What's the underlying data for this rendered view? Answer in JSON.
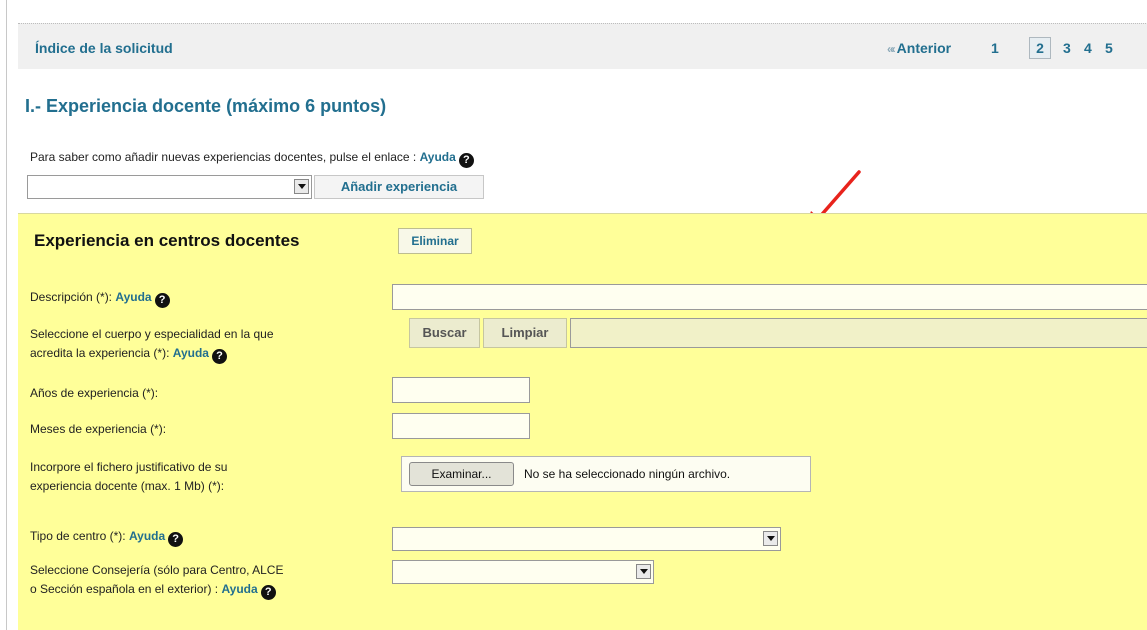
{
  "header": {
    "index_link": "Índice de la solicitud",
    "pager": {
      "prev_label": "Anterior",
      "pages": [
        "1",
        "2",
        "3",
        "4",
        "5"
      ],
      "current": "2"
    }
  },
  "section": {
    "title": "I.- Experiencia docente (máximo 6 puntos)",
    "hint_text": "Para saber como añadir nuevas experiencias docentes, pulse el enlace : ",
    "help_label": "Ayuda",
    "add_select_value": "",
    "add_button": "Añadir experiencia"
  },
  "card": {
    "title": "Experiencia en centros docentes",
    "delete_button": "Eliminar",
    "fields": {
      "descripcion": {
        "label": "Descripción (*): ",
        "help": "Ayuda",
        "value": ""
      },
      "cuerpo": {
        "label_line1": "Seleccione el cuerpo y especialidad en la que",
        "label_line2": "acredita la experiencia (*): ",
        "help": "Ayuda",
        "search_button": "Buscar",
        "clear_button": "Limpiar",
        "value": ""
      },
      "anios": {
        "label": "Años de experiencia (*):",
        "value": ""
      },
      "meses": {
        "label": "Meses de experiencia (*):",
        "value": ""
      },
      "fichero": {
        "label_line1": "Incorpore el fichero justificativo de su",
        "label_line2": "experiencia docente (max. 1 Mb) (*):",
        "browse_button": "Examinar...",
        "no_file_text": "No se ha seleccionado ningún archivo."
      },
      "tipo_centro": {
        "label": "Tipo de centro (*): ",
        "help": "Ayuda",
        "value": ""
      },
      "consejeria": {
        "label_line1": "Seleccione Consejería (sólo para Centro, ALCE",
        "label_line2": "o Sección española en el exterior) : ",
        "help": "Ayuda",
        "value": ""
      }
    }
  },
  "colors": {
    "link": "#226f8f",
    "card_bg": "#ffff99",
    "annotation_arrow": "#e8231c"
  },
  "icons": {
    "help": "question-circle-icon",
    "prev": "double-chevron-left-icon",
    "dropdown": "chevron-down-icon",
    "annotation": "red-arrow-icon"
  }
}
